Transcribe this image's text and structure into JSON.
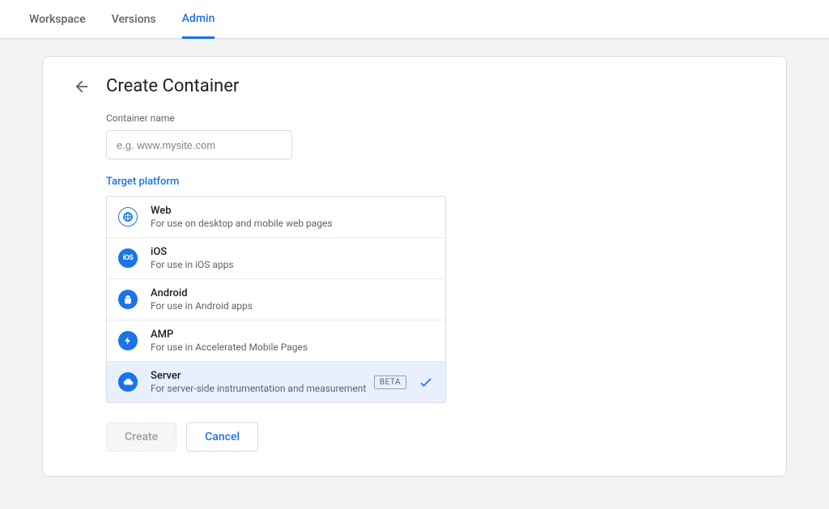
{
  "tabs": {
    "workspace": "Workspace",
    "versions": "Versions",
    "admin": "Admin"
  },
  "page": {
    "title": "Create Container"
  },
  "form": {
    "name_label": "Container name",
    "name_placeholder": "e.g. www.mysite.com",
    "target_label": "Target platform"
  },
  "platforms": [
    {
      "title": "Web",
      "desc": "For use on desktop and mobile web pages",
      "selected": false,
      "beta": false
    },
    {
      "title": "iOS",
      "desc": "For use in iOS apps",
      "selected": false,
      "beta": false
    },
    {
      "title": "Android",
      "desc": "For use in Android apps",
      "selected": false,
      "beta": false
    },
    {
      "title": "AMP",
      "desc": "For use in Accelerated Mobile Pages",
      "selected": false,
      "beta": false
    },
    {
      "title": "Server",
      "desc": "For server-side instrumentation and measurement",
      "selected": true,
      "beta": true
    }
  ],
  "buttons": {
    "create": "Create",
    "cancel": "Cancel"
  },
  "beta_label": "BETA"
}
